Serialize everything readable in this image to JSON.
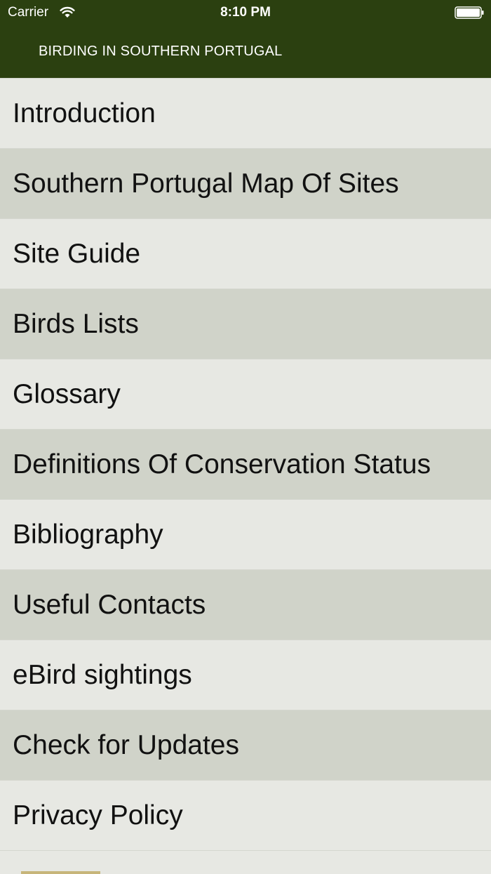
{
  "status_bar": {
    "carrier": "Carrier",
    "time": "8:10 PM",
    "wifi_icon": "wifi-icon",
    "battery_icon": "battery-icon"
  },
  "header": {
    "title": "BIRDING IN SOUTHERN PORTUGAL",
    "background_color": "#2b4010"
  },
  "menu": {
    "items": [
      {
        "label": "Introduction"
      },
      {
        "label": "Southern Portugal Map Of Sites"
      },
      {
        "label": "Site Guide"
      },
      {
        "label": "Birds Lists"
      },
      {
        "label": "Glossary"
      },
      {
        "label": "Definitions Of Conservation Status"
      },
      {
        "label": "Bibliography"
      },
      {
        "label": "Useful Contacts"
      },
      {
        "label": "eBird sightings"
      },
      {
        "label": "Check for Updates"
      },
      {
        "label": "Privacy Policy"
      }
    ],
    "row_colors": [
      "#e7e8e3",
      "#d0d3c9"
    ]
  }
}
